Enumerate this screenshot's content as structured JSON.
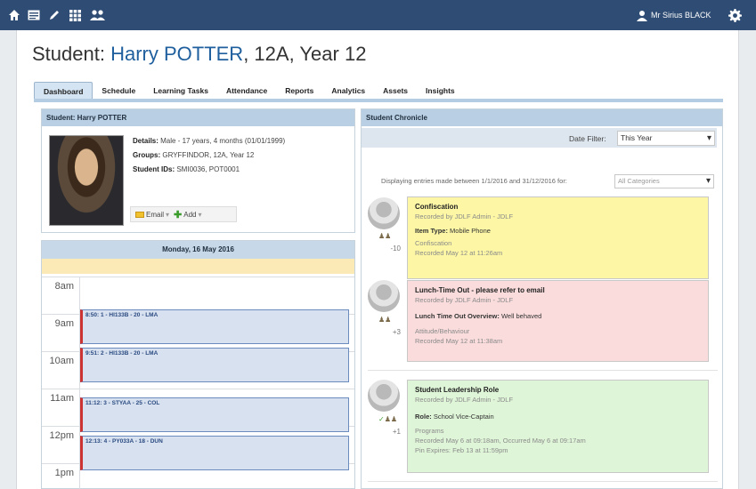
{
  "topbar": {
    "user": "Mr Sirius BLACK",
    "icons": [
      "home-icon",
      "id-card-icon",
      "pencil-icon",
      "grid-icon",
      "people-icon"
    ]
  },
  "title": {
    "prefix": "Student: ",
    "name": "Harry POTTER",
    "suffix": ", 12A, Year 12"
  },
  "tabs": [
    "Dashboard",
    "Schedule",
    "Learning Tasks",
    "Attendance",
    "Reports",
    "Analytics",
    "Assets",
    "Insights"
  ],
  "student": {
    "heading": "Student: Harry POTTER",
    "details_label": "Details:",
    "details": "Male - 17 years, 4 months (01/01/1999)",
    "groups_label": "Groups:",
    "groups": "GRYFFINDOR, 12A, Year 12",
    "ids_label": "Student IDs:",
    "ids": "SMI0036, POT0001",
    "email": "Email",
    "add": "Add"
  },
  "calendar": {
    "date": "Monday, 16 May 2016",
    "hours": [
      "8am",
      "9am",
      "10am",
      "11am",
      "12pm",
      "1pm"
    ],
    "events": [
      "8:50: 1 - HI133B - 20 - LMA",
      "9:51: 2 - HI133B - 20 - LMA",
      "11:12: 3 - STYAA - 25 - COL",
      "12:13: 4 - PY033A - 18 - DUN"
    ]
  },
  "chronicle": {
    "heading": "Student Chronicle",
    "filter_label": "Date Filter:",
    "filter_value": "This Year",
    "range_text": "Displaying entries made between 1/1/2016 and 31/12/2016 for:",
    "category": "All Categories",
    "entries": [
      {
        "title": "Confiscation",
        "by": "Recorded by JDLF Admin - JDLF",
        "field_label": "Item Type:",
        "field_value": "Mobile Phone",
        "category": "Confiscation",
        "recorded": "Recorded May 12 at 11:26am",
        "extra": "",
        "score": "-10",
        "color": "#fdf7a5"
      },
      {
        "title": "Lunch-Time Out - please refer to email",
        "by": "Recorded by JDLF Admin - JDLF",
        "field_label": "Lunch Time Out Overview:",
        "field_value": "Well behaved",
        "category": "Attitude/Behaviour",
        "recorded": "Recorded May 12 at 11:38am",
        "extra": "",
        "score": "+3",
        "color": "#fadcdc"
      },
      {
        "title": "Student Leadership Role",
        "by": "Recorded by JDLF Admin - JDLF",
        "field_label": "Role:",
        "field_value": "School Vice-Captain",
        "category": "Programs",
        "recorded": "Recorded May 6 at 09:18am, Occurred May 6 at 09:17am",
        "extra": "Pin Expires: Feb 13 at 11:59pm",
        "score": "+1",
        "color": "#dff5d8"
      }
    ]
  },
  "colors": {
    "topbar": "#2f4d74",
    "accent": "#1f5f9e",
    "panel_head": "#b9cfe3"
  }
}
